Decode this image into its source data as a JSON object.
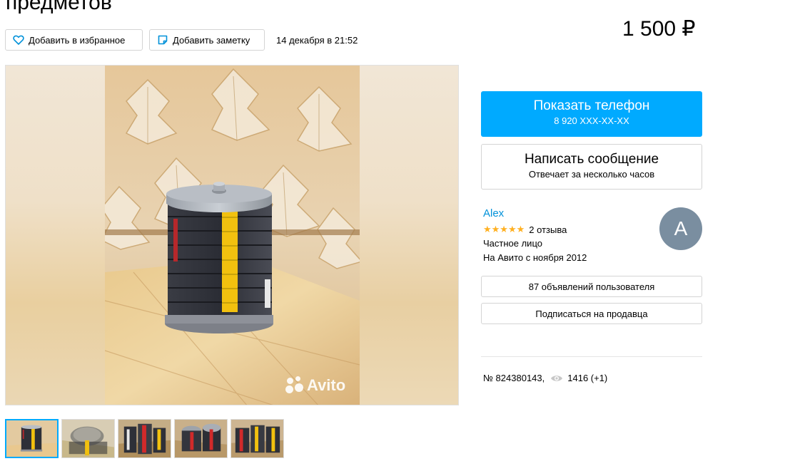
{
  "listing": {
    "title": "предметов",
    "price": "1 500 ₽",
    "date": "14 декабря в 21:52"
  },
  "actions": {
    "favorite_label": "Добавить в избранное",
    "note_label": "Добавить заметку"
  },
  "gallery": {
    "watermark": "Avito",
    "thumbnail_count": 5,
    "active_thumbnail": 1
  },
  "contact": {
    "phone_label": "Показать телефон",
    "phone_number": "8 920 XXX-XX-XX",
    "message_label": "Написать сообщение",
    "message_sub": "Отвечает за несколько часов"
  },
  "seller": {
    "name": "Alex",
    "stars": "★★★★★",
    "rating": 5,
    "reviews": "2 отзыва",
    "type": "Частное лицо",
    "since": "На Авито с ноября 2012",
    "avatar_letter": "A",
    "ads_label": "87 объявлений пользователя",
    "subscribe_label": "Подписаться на продавца"
  },
  "meta": {
    "number": "№ 824380143,",
    "views": "1416 (+1)"
  },
  "colors": {
    "accent": "#00aaff",
    "link": "#0091d9",
    "stars": "#ffb021",
    "avatar_bg": "#7a8ea0"
  },
  "icons": {
    "favorite": "heart-icon",
    "note": "note-icon",
    "views": "eye-icon",
    "watermark": "avito-logo-icon"
  }
}
